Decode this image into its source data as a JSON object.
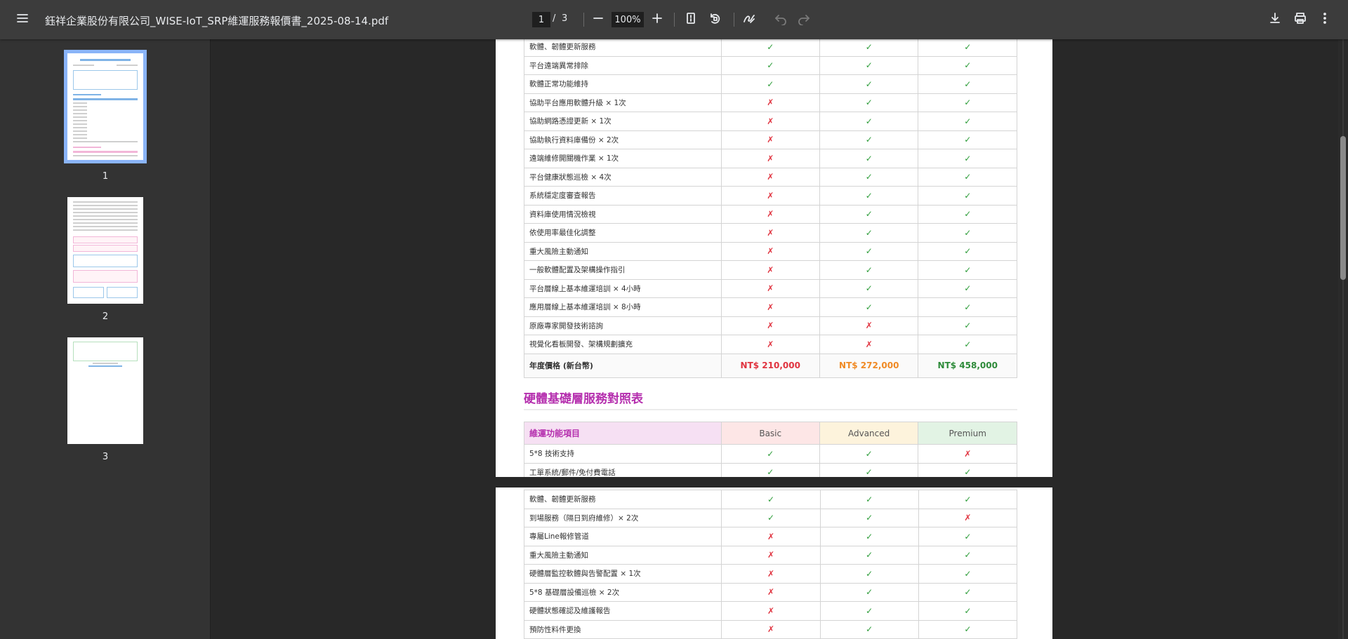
{
  "toolbar": {
    "title": "鈺祥企業股份有限公司_WISE-IoT_SRP維運服務報價書_2025-08-14.pdf",
    "current_page": "1",
    "page_separator": "/",
    "total_pages": "3",
    "zoom": "100%"
  },
  "sidebar": {
    "thumbnails": [
      {
        "label": "1"
      },
      {
        "label": "2"
      },
      {
        "label": "3"
      }
    ]
  },
  "page1": {
    "rows": [
      {
        "item": "軟體、韌體更新服務",
        "basic": "✓",
        "advanced": "✓",
        "premium": "✓"
      },
      {
        "item": "平台遠端異常排除",
        "basic": "✓",
        "advanced": "✓",
        "premium": "✓"
      },
      {
        "item": "軟體正常功能維持",
        "basic": "✓",
        "advanced": "✓",
        "premium": "✓"
      },
      {
        "item": "協助平台應用軟體升級 × 1次",
        "basic": "✗",
        "advanced": "✓",
        "premium": "✓"
      },
      {
        "item": "協助網路憑證更新 × 1次",
        "basic": "✗",
        "advanced": "✓",
        "premium": "✓"
      },
      {
        "item": "協助執行資料庫備份 × 2次",
        "basic": "✗",
        "advanced": "✓",
        "premium": "✓"
      },
      {
        "item": "遠端維修開關機作業 × 1次",
        "basic": "✗",
        "advanced": "✓",
        "premium": "✓"
      },
      {
        "item": "平台健康狀態巡檢 × 4次",
        "basic": "✗",
        "advanced": "✓",
        "premium": "✓"
      },
      {
        "item": "系統穩定度審查報告",
        "basic": "✗",
        "advanced": "✓",
        "premium": "✓"
      },
      {
        "item": "資料庫使用情況檢視",
        "basic": "✗",
        "advanced": "✓",
        "premium": "✓"
      },
      {
        "item": "依使用率最佳化調整",
        "basic": "✗",
        "advanced": "✓",
        "premium": "✓"
      },
      {
        "item": "重大風險主動通知",
        "basic": "✗",
        "advanced": "✓",
        "premium": "✓"
      },
      {
        "item": "一般軟體配置及架構操作指引",
        "basic": "✗",
        "advanced": "✓",
        "premium": "✓"
      },
      {
        "item": "平台層線上基本維運培訓 × 4小時",
        "basic": "✗",
        "advanced": "✓",
        "premium": "✓"
      },
      {
        "item": "應用層線上基本維運培訓 × 8小時",
        "basic": "✗",
        "advanced": "✓",
        "premium": "✓"
      },
      {
        "item": "原廠專家開發技術諮詢",
        "basic": "✗",
        "advanced": "✗",
        "premium": "✓"
      },
      {
        "item": "視覺化看板開發、架構規劃擴充",
        "basic": "✗",
        "advanced": "✗",
        "premium": "✓"
      }
    ],
    "price_row": {
      "item": "年度價格 (新台幣)",
      "basic": "NT$ 210,000",
      "advanced": "NT$ 272,000",
      "premium": "NT$ 458,000"
    },
    "hardware_section_title": "硬體基礎層服務對照表",
    "hardware_header": {
      "item": "維運功能項目",
      "basic": "Basic",
      "advanced": "Advanced",
      "premium": "Premium"
    },
    "hardware_rows": [
      {
        "item": "5*8 技術支持",
        "basic": "✓",
        "advanced": "✓",
        "premium": "✗"
      },
      {
        "item": "工單系統/郵件/免付費電話",
        "basic": "✓",
        "advanced": "✓",
        "premium": "✓"
      }
    ]
  },
  "page2": {
    "rows": [
      {
        "item": "軟體、韌體更新服務",
        "basic": "✓",
        "advanced": "✓",
        "premium": "✓"
      },
      {
        "item": "到場服務（隔日到府維修）× 2次",
        "basic": "✓",
        "advanced": "✓",
        "premium": "✗"
      },
      {
        "item": "專屬Line報修管道",
        "basic": "✗",
        "advanced": "✓",
        "premium": "✓"
      },
      {
        "item": "重大風險主動通知",
        "basic": "✗",
        "advanced": "✓",
        "premium": "✓"
      },
      {
        "item": "硬體層監控軟體與告警配置 × 1次",
        "basic": "✗",
        "advanced": "✓",
        "premium": "✓"
      },
      {
        "item": "5*8 基礎層設備巡檢 × 2次",
        "basic": "✗",
        "advanced": "✓",
        "premium": "✓"
      },
      {
        "item": "硬體狀態確認及維護報告",
        "basic": "✗",
        "advanced": "✓",
        "premium": "✓"
      },
      {
        "item": "預防性料件更換",
        "basic": "✗",
        "advanced": "✓",
        "premium": "✓"
      }
    ]
  },
  "colors": {
    "toolbar_bg": "#3c3c3c",
    "sidebar_bg": "#333333",
    "viewer_bg": "#282828",
    "check_green": "#2e9d3a",
    "cross_red": "#e0333f",
    "section_purple": "#b52fae",
    "thumbnail_selected": "#8ab4f8"
  },
  "icons": [
    "menu-icon",
    "zoom-out-icon",
    "zoom-in-icon",
    "fit-page-icon",
    "rotate-icon",
    "annotate-icon",
    "undo-icon",
    "redo-icon",
    "download-icon",
    "print-icon",
    "more-icon"
  ]
}
